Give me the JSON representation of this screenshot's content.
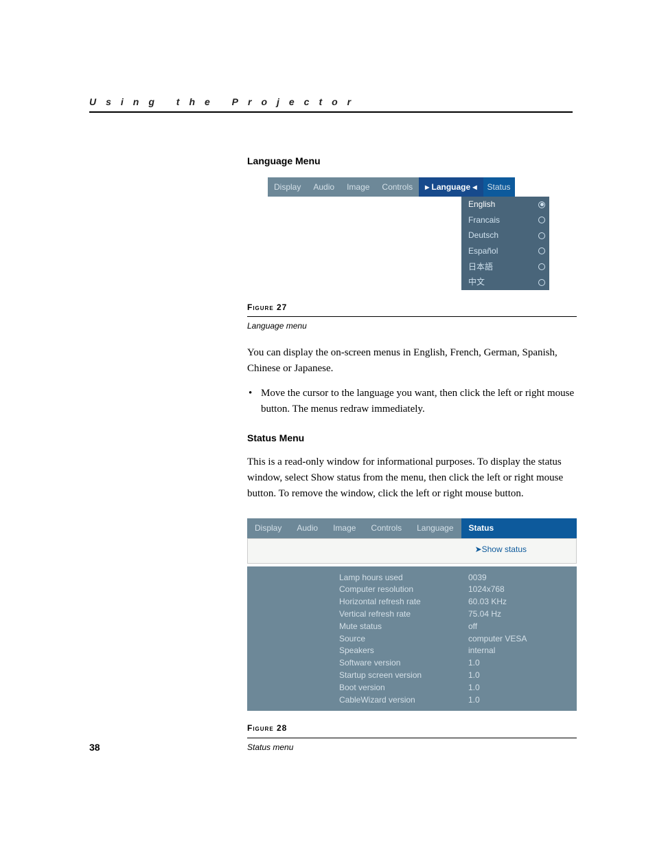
{
  "runningHead": "Using the Projector",
  "page_number": "38",
  "section1": {
    "heading": "Language Menu",
    "figure_label": "Figure 27",
    "figure_caption": "Language menu",
    "para1": "You can display the on-screen menus in English, French, German, Spanish, Chinese or Japanese.",
    "bullet1": "Move the cursor to the language you want, then click the left or right mouse button. The menus redraw immediately."
  },
  "langmenu": {
    "tabs": [
      "Display",
      "Audio",
      "Image",
      "Controls",
      "Language",
      "Status"
    ],
    "active_tab": "Language",
    "active_markers": {
      "left": "▸",
      "right": "◂"
    },
    "items": [
      {
        "label": "English",
        "selected": true
      },
      {
        "label": "Francais",
        "selected": false
      },
      {
        "label": "Deutsch",
        "selected": false
      },
      {
        "label": "Español",
        "selected": false
      },
      {
        "label": "日本語",
        "selected": false
      },
      {
        "label": "中文",
        "selected": false
      }
    ]
  },
  "section2": {
    "heading": "Status Menu",
    "para1": "This is a read-only window for informational purposes. To display the status window, select Show status from the menu, then click the left or right mouse button. To remove the window, click the left or right mouse button.",
    "figure_label": "Figure 28",
    "figure_caption": "Status menu"
  },
  "statusmenu": {
    "tabs": [
      "Display",
      "Audio",
      "Image",
      "Controls",
      "Language",
      "Status"
    ],
    "active_tab": "Status",
    "show_status_label": "Show status",
    "show_status_prefix": "➤",
    "rows": [
      {
        "label": "Lamp hours used",
        "value": "0039"
      },
      {
        "label": "Computer resolution",
        "value": "1024x768"
      },
      {
        "label": "Horizontal refresh rate",
        "value": "60.03 KHz"
      },
      {
        "label": "Vertical refresh rate",
        "value": "75.04 Hz"
      },
      {
        "label": "Mute status",
        "value": "off"
      },
      {
        "label": "Source",
        "value": "computer VESA"
      },
      {
        "label": "Speakers",
        "value": "internal"
      },
      {
        "label": "Software version",
        "value": "1.0"
      },
      {
        "label": "Startup screen version",
        "value": "1.0"
      },
      {
        "label": "Boot version",
        "value": "1.0"
      },
      {
        "label": "CableWizard version",
        "value": "1.0"
      }
    ]
  }
}
